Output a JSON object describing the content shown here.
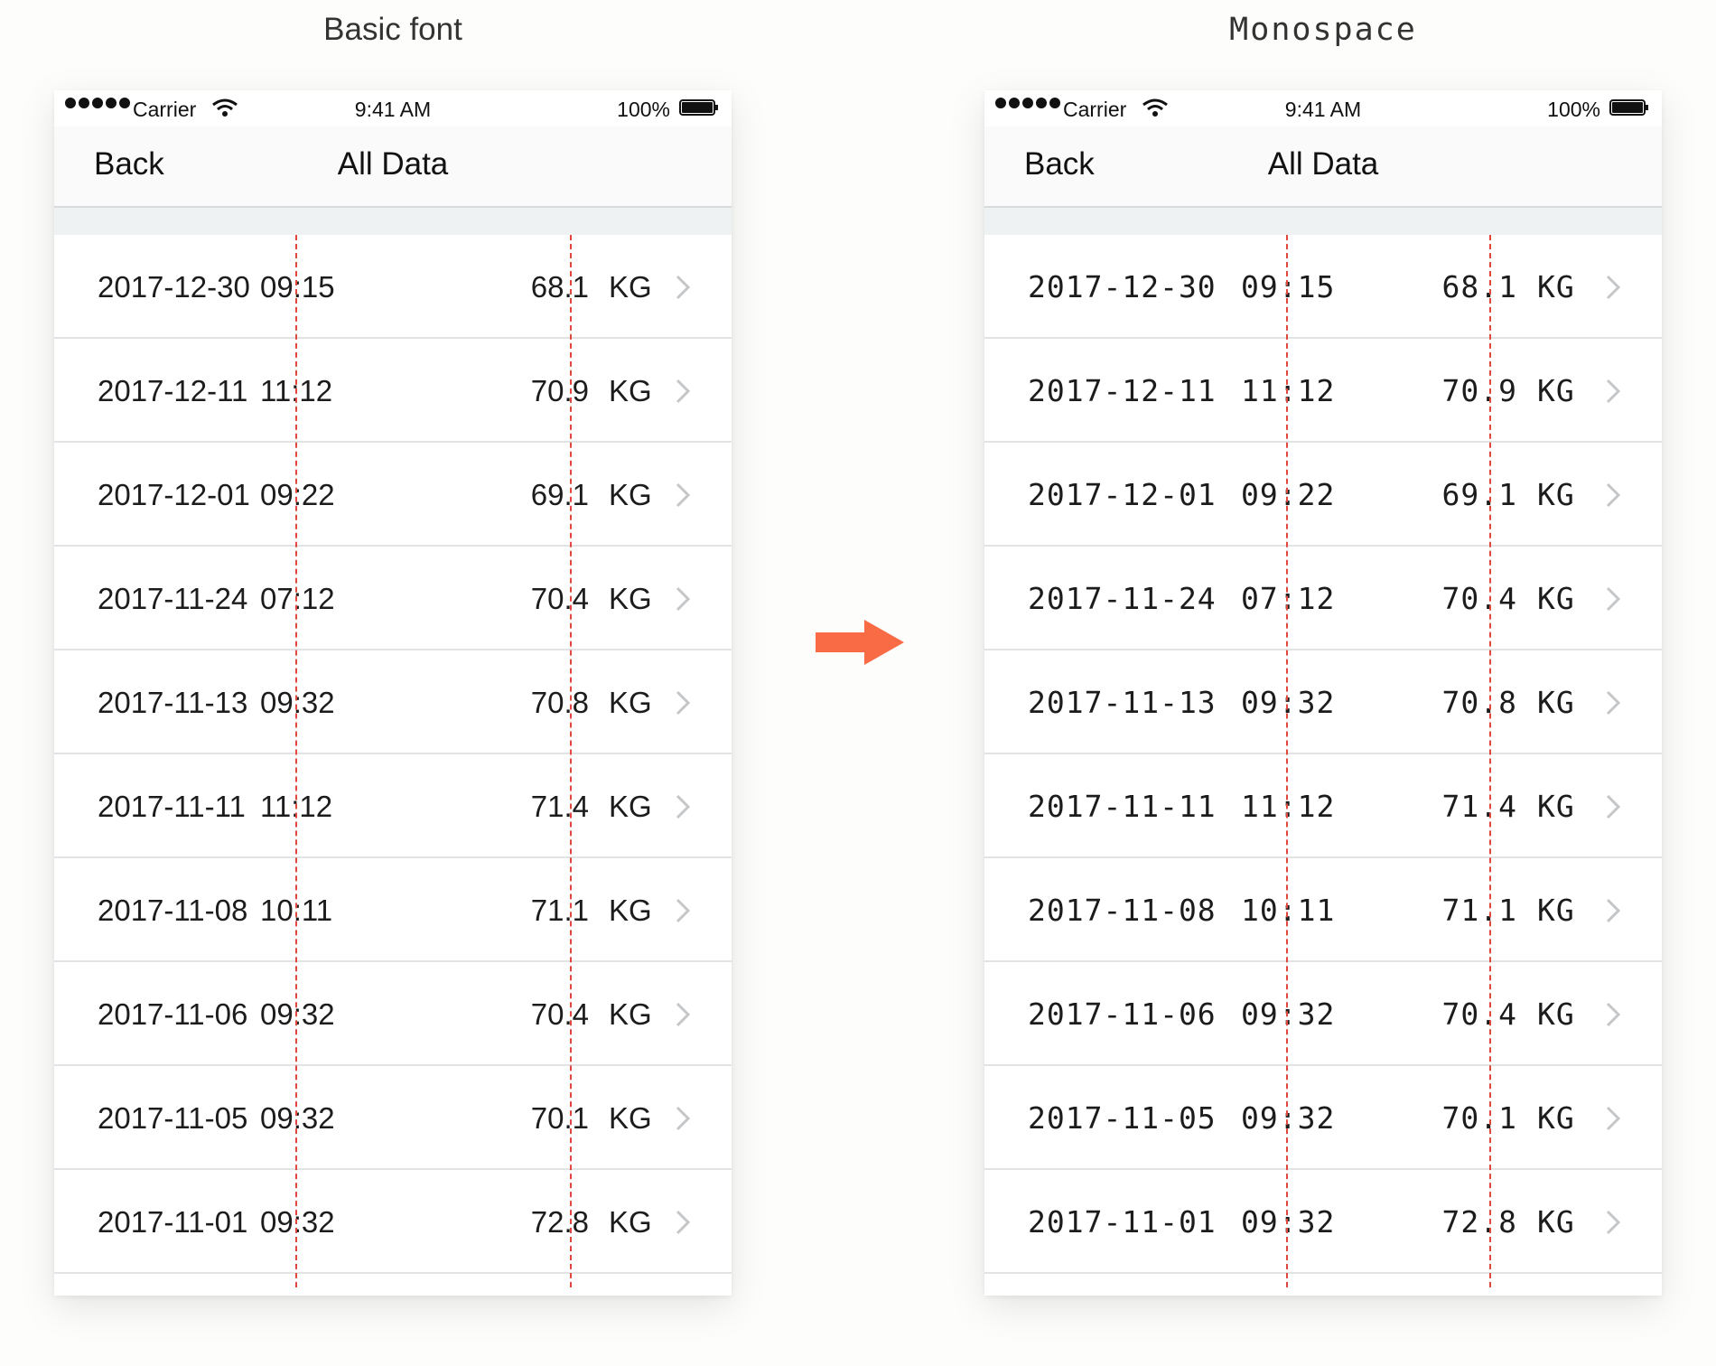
{
  "captions": {
    "basic": "Basic font",
    "mono": "Monospace"
  },
  "status": {
    "carrier": "Carrier",
    "time": "9:41 AM",
    "battery": "100%"
  },
  "nav": {
    "back": "Back",
    "title": "All Data"
  },
  "unit": "KG",
  "rows": [
    {
      "date": "2017-12-30",
      "time": "09:15",
      "value": "68.1"
    },
    {
      "date": "2017-12-11",
      "time": "11:12",
      "value": "70.9"
    },
    {
      "date": "2017-12-01",
      "time": "09:22",
      "value": "69.1"
    },
    {
      "date": "2017-11-24",
      "time": "07:12",
      "value": "70.4"
    },
    {
      "date": "2017-11-13",
      "time": "09:32",
      "value": "70.8"
    },
    {
      "date": "2017-11-11",
      "time": "11:12",
      "value": "71.4"
    },
    {
      "date": "2017-11-08",
      "time": "10:11",
      "value": "71.1"
    },
    {
      "date": "2017-11-06",
      "time": "09:32",
      "value": "70.4"
    },
    {
      "date": "2017-11-05",
      "time": "09:32",
      "value": "70.1"
    },
    {
      "date": "2017-11-01",
      "time": "09:32",
      "value": "72.8"
    }
  ],
  "colors": {
    "guide": "#e0483e",
    "arrow": "#f96b45"
  },
  "icons": [
    "signal-dots-icon",
    "wifi-icon",
    "battery-icon",
    "chevron-right-icon",
    "arrow-right-icon"
  ]
}
